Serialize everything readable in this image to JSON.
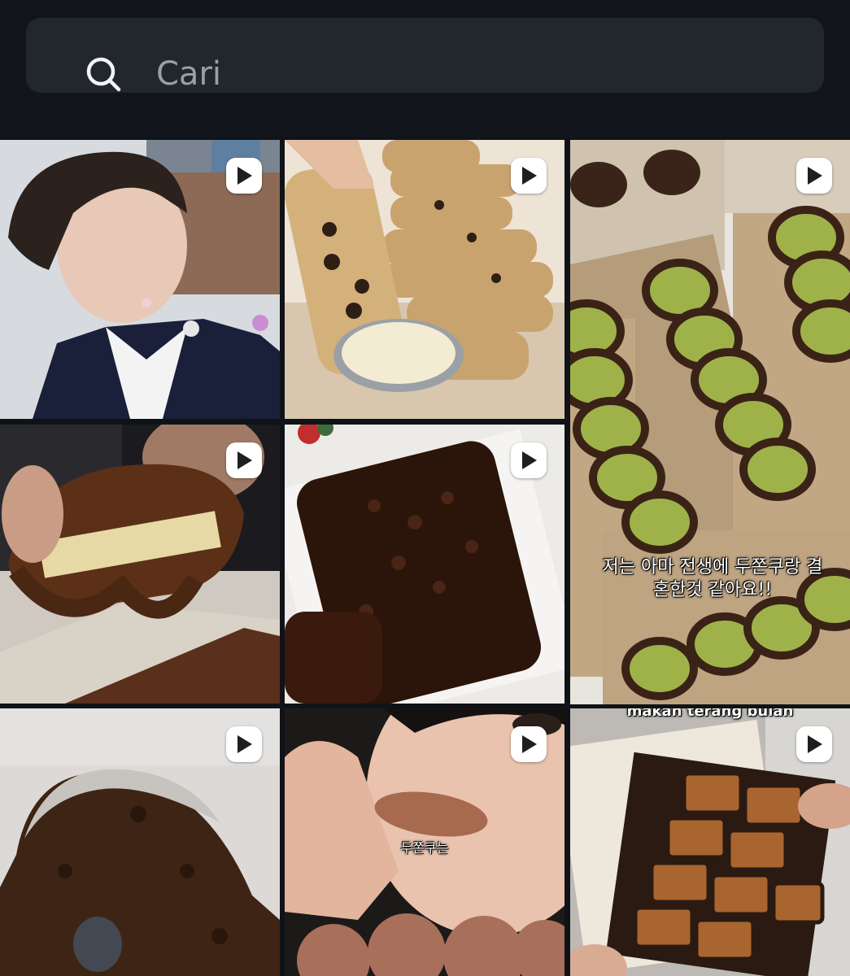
{
  "search": {
    "placeholder": "Cari",
    "value": ""
  },
  "tiles": [
    {
      "type": "video",
      "caption": ""
    },
    {
      "type": "video",
      "caption": ""
    },
    {
      "type": "video",
      "caption": "저는 아마 전생에 두쫀쿠랑 결\n혼한것 같아요!!"
    },
    {
      "type": "video",
      "caption": ""
    },
    {
      "type": "video",
      "caption": ""
    },
    {
      "type": "video",
      "caption": ""
    },
    {
      "type": "video",
      "caption": "두쫀쿠는"
    },
    {
      "type": "video",
      "caption": "makan terang bulan"
    }
  ],
  "colors": {
    "background": "#0f1318",
    "search_field": "#22262d",
    "play_badge": "#ffffff"
  },
  "icons": {
    "search": "search-icon",
    "video_badge": "play-icon"
  }
}
